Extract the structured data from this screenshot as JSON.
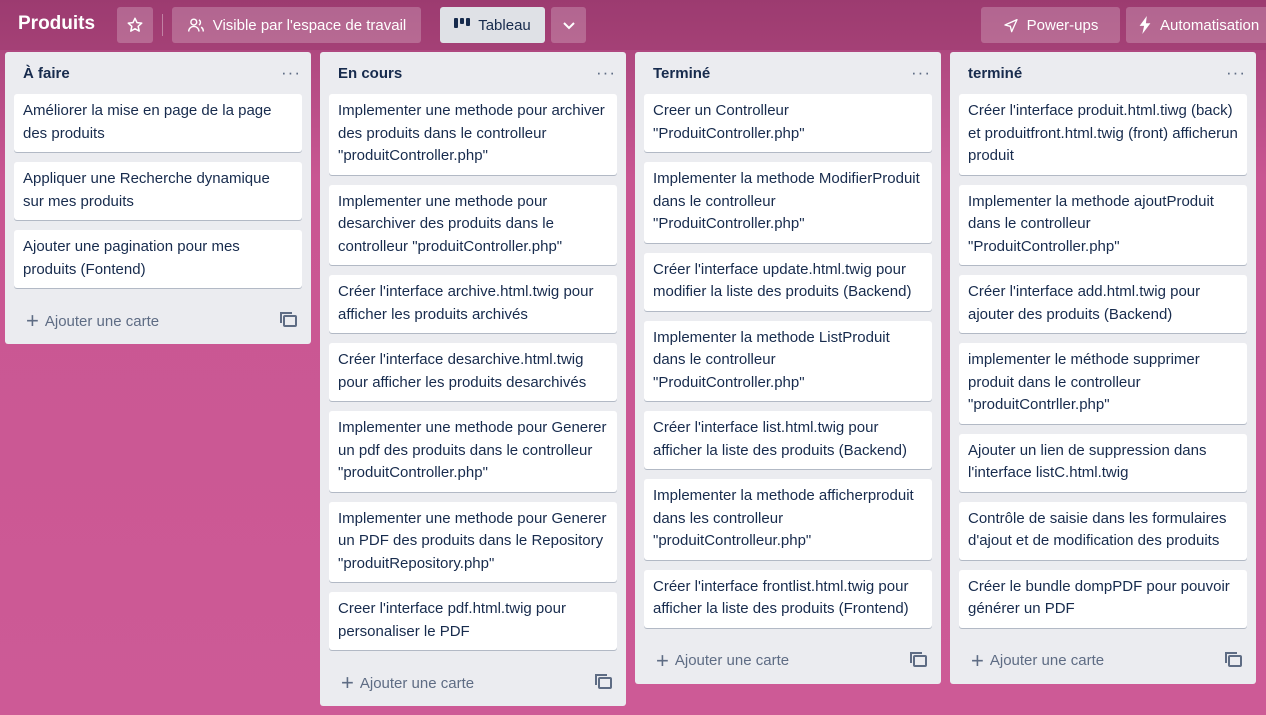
{
  "board": {
    "title": "Produits",
    "visibility_label": "Visible par l'espace de travail",
    "view_label": "Tableau",
    "powerups_label": "Power-ups",
    "automation_label": "Automatisation"
  },
  "add_card_label": "Ajouter une carte",
  "lists": [
    {
      "title": "À faire",
      "cards": [
        "Améliorer la mise en page de la page des produits",
        "Appliquer une Recherche dynamique sur mes produits",
        "Ajouter une pagination pour mes produits (Fontend)"
      ]
    },
    {
      "title": "En cours",
      "cards": [
        "Implementer une methode pour archiver des produits dans le controlleur \"produitController.php\"",
        "Implementer une methode pour desarchiver des produits dans le controlleur \"produitController.php\"",
        "Créer l'interface archive.html.twig pour afficher les produits archivés",
        "Créer l'interface desarchive.html.twig pour afficher les produits desarchivés",
        "Implementer une methode pour Generer un pdf des produits dans le controlleur \"produitController.php\"",
        "Implementer une methode pour Generer un PDF des produits dans le Repository \"produitRepository.php\"",
        "Creer l'interface pdf.html.twig pour personaliser le PDF"
      ]
    },
    {
      "title": "Terminé",
      "cards": [
        "Creer un Controlleur \"ProduitController.php\"",
        "Implementer la methode ModifierProduit dans le controlleur \"ProduitController.php\"",
        "Créer l'interface update.html.twig pour modifier la liste des produits (Backend)",
        "Implementer la methode ListProduit dans le controlleur \"ProduitController.php\"",
        "Créer l'interface list.html.twig pour afficher la liste des produits (Backend)",
        "Implementer la methode afficherproduit dans les controlleur \"produitControlleur.php\"",
        "Créer l'interface frontlist.html.twig pour afficher la liste des produits (Frontend)"
      ]
    },
    {
      "title": "terminé",
      "cards": [
        "Créer l'interface produit.html.tiwg (back) et produitfront.html.twig (front) afficherun produit",
        "Implementer la methode ajoutProduit dans le controlleur \"ProduitController.php\"",
        "Créer l'interface add.html.twig pour ajouter des produits (Backend)",
        "implementer le méthode supprimer produit dans le controlleur \"produitContrller.php\"",
        "Ajouter un lien de suppression dans l'interface listC.html.twig",
        "Contrôle de saisie dans les formulaires d'ajout et de modification des produits",
        "Créer le bundle dompPDF pour pouvoir générer un PDF"
      ]
    }
  ]
}
